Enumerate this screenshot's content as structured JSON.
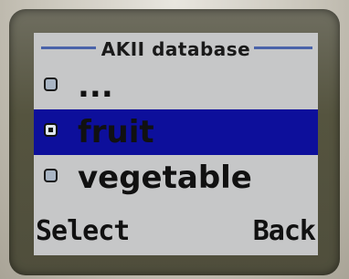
{
  "screen": {
    "title": "AKII database",
    "accent_color": "#4a63a9",
    "selection_color": "#0d0f9b",
    "background_color": "#c6c7c8"
  },
  "list": {
    "items": [
      {
        "label": "...",
        "radio_selected": false,
        "highlighted": false
      },
      {
        "label": "fruit",
        "radio_selected": true,
        "highlighted": true
      },
      {
        "label": "vegetable",
        "radio_selected": false,
        "highlighted": false
      }
    ]
  },
  "softkeys": {
    "left": "Select",
    "right": "Back"
  }
}
